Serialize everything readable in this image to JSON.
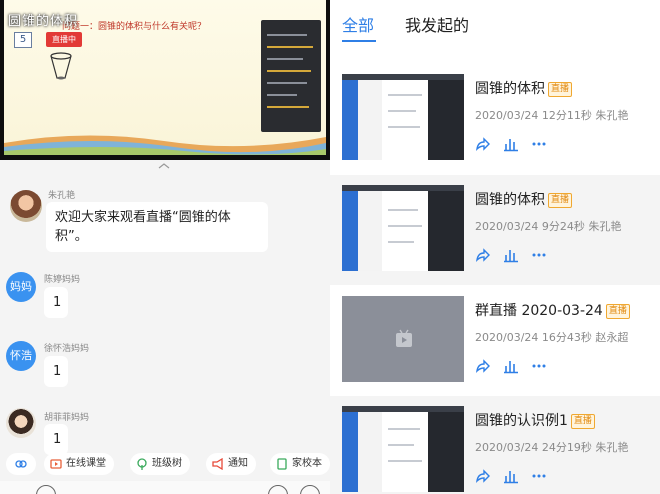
{
  "video": {
    "overlay_title": "圆锥的体积",
    "logo_text": "5",
    "question": "问题一：圆锥的体积与什么有关呢？",
    "live_badge": "直播中"
  },
  "chat": {
    "messages": [
      {
        "sender": "朱孔艳",
        "avatar": "",
        "text": "欢迎大家来观看直播“圆锥的体积”。"
      },
      {
        "sender": "陈婷妈妈",
        "avatar": "妈妈",
        "text": "1"
      },
      {
        "sender": "徐怀浩妈妈",
        "avatar": "怀浩",
        "text": "1"
      },
      {
        "sender": "胡菲菲妈妈",
        "avatar": "",
        "text": "1"
      }
    ]
  },
  "toolbar": {
    "items": [
      "在线课堂",
      "班级树",
      "通知",
      "家校本"
    ]
  },
  "tabs": {
    "all": "全部",
    "mine": "我发起的"
  },
  "cards": [
    {
      "title": "圆锥的体积",
      "tag": "直播",
      "meta": "2020/03/24 12分11秒 朱孔艳"
    },
    {
      "title": "圆锥的体积",
      "tag": "直播",
      "meta": "2020/03/24 9分24秒 朱孔艳"
    },
    {
      "title": "群直播 2020-03-24",
      "tag": "直播",
      "meta": "2020/03/24 16分43秒 赵永超"
    },
    {
      "title": "圆锥的认识例1",
      "tag": "直播",
      "meta": "2020/03/24 24分19秒 朱孔艳"
    }
  ],
  "colors": {
    "accent": "#2f7fe6",
    "tag": "#e28a10",
    "live": "#e23a36"
  }
}
